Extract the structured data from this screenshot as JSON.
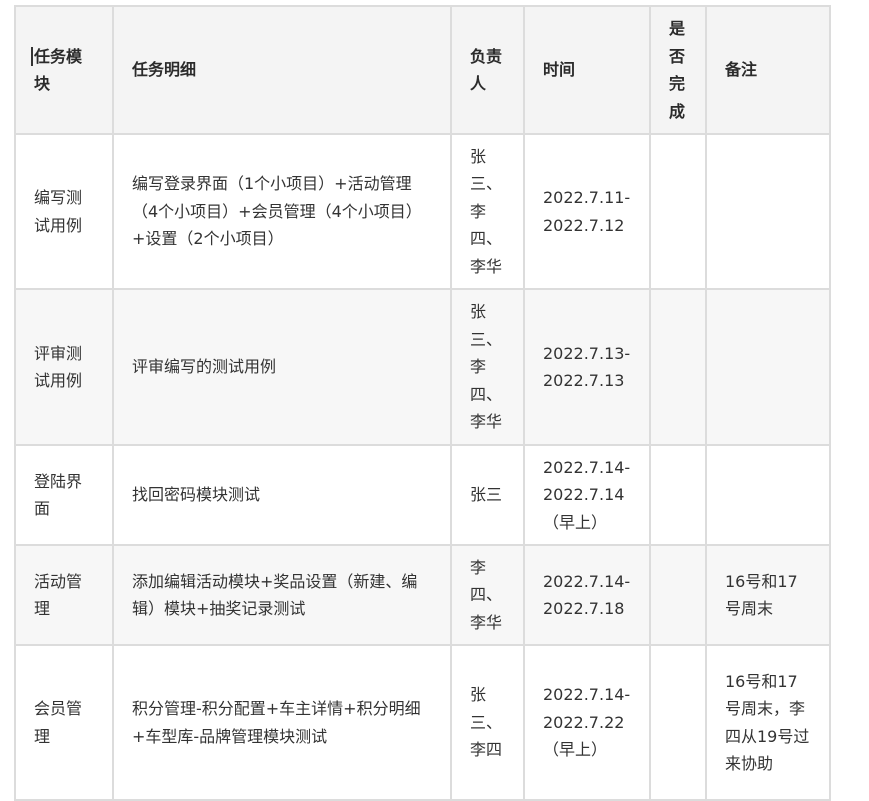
{
  "headers": {
    "module": "任务模块",
    "detail": "任务明细",
    "owner": "负责人",
    "time": "时间",
    "done": "是否完成",
    "note": "备注"
  },
  "rows": [
    {
      "module": "编写测试用例",
      "detail": "编写登录界面（1个小项目）+活动管理（4个小项目）+会员管理（4个小项目）+设置（2个小项目）",
      "owner": "张三、李四、李华",
      "time": "2022.7.11-2022.7.12",
      "done": "",
      "note": ""
    },
    {
      "module": "评审测试用例",
      "detail": "评审编写的测试用例",
      "owner": "张三、李四、李华",
      "time": "2022.7.13-2022.7.13",
      "done": "",
      "note": ""
    },
    {
      "module": "登陆界面",
      "detail": "找回密码模块测试",
      "owner": "张三",
      "time": "2022.7.14-2022.7.14（早上）",
      "done": "",
      "note": ""
    },
    {
      "module": "活动管理",
      "detail": "添加编辑活动模块+奖品设置（新建、编辑）模块+抽奖记录测试",
      "owner": "李四、李华",
      "time": "2022.7.14-2022.7.18",
      "done": "",
      "note": "16号和17号周末"
    },
    {
      "module": "会员管理",
      "detail": "积分管理-积分配置+车主详情+积分明细+车型库-品牌管理模块测试",
      "owner": "张三、李四",
      "time": "2022.7.14-2022.7.22（早上）",
      "done": "",
      "note": "16号和17号周末，李四从19号过来协助"
    }
  ]
}
